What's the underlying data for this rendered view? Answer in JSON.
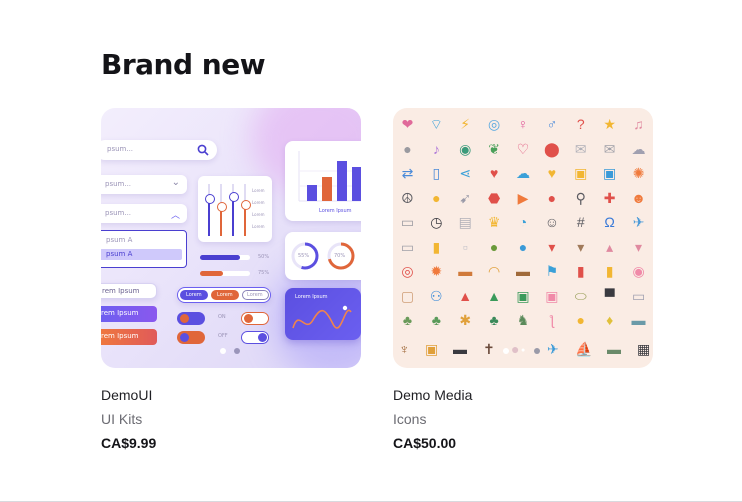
{
  "section": {
    "title": "Brand new"
  },
  "products": [
    {
      "name": "DemoUI",
      "category": "UI Kits",
      "price": "CA$9.99",
      "preview": {
        "search_placeholder": "psum...",
        "dropdown1": "psum...",
        "dropdown2": "psum...",
        "list_item1": "psum A",
        "list_item2": "psum A",
        "input_text": "rem Ipsum",
        "button1": "rem Ipsum",
        "button2": "rem Ipsum",
        "chart_caption": "Lorem Ipsum",
        "seg1": "Lorem",
        "seg2": "Lorem",
        "seg3": "Lorem",
        "toggle_on": "ON",
        "toggle_off": "OFF",
        "progress1": "50%",
        "progress2": "75%",
        "donut1": "55%",
        "donut2": "70%",
        "wave_title": "Lorem Ipsum",
        "slider_labels": [
          "Lorem",
          "Lorem",
          "Lorem",
          "Lorem"
        ]
      }
    },
    {
      "name": "Demo Media",
      "category": "Icons",
      "price": "CA$50.00",
      "preview": {
        "icons": [
          "heart-icon",
          "wifi-icon",
          "lightning-icon",
          "globe-icon",
          "female-icon",
          "male-icon",
          "question-icon",
          "star-icon",
          "music-icon",
          "chat-icon",
          "chat-music-icon",
          "earth-icon",
          "leaf-icon",
          "ribbon-icon",
          "pin-icon",
          "mail-open-icon",
          "mail-icon",
          "cloud-icon",
          "shuffle-icon",
          "phone-icon",
          "share-icon",
          "heartbeat-icon",
          "cloud-upload-icon",
          "heart-rainbow-icon",
          "lock-icon",
          "lock-open-icon",
          "gear-icon",
          "peace-icon",
          "coin-icon",
          "rocket-icon",
          "stop-sign-icon",
          "play-icon",
          "alert-icon",
          "magnifier-icon",
          "first-aid-icon",
          "user-icon",
          "tablet-icon",
          "clock-icon",
          "newspaper-icon",
          "trophy-icon",
          "pie-chart-icon",
          "smile-icon",
          "hashtag-icon",
          "headphones-icon",
          "plane-icon",
          "mug-icon",
          "drink-icon",
          "paper-icon",
          "avocado-icon",
          "hi-bubble-icon",
          "popcorn-icon",
          "coffee-icon",
          "cupcake-icon",
          "ice-drink-icon",
          "target-icon",
          "orange-icon",
          "hotdog-icon",
          "taco-icon",
          "burger-icon",
          "flag-icon",
          "bottles-icon",
          "sauce-icon",
          "donut-icon",
          "bag-icon",
          "scooter-icon",
          "hydrant-icon",
          "tree-icon",
          "gift-icon",
          "backpack-icon",
          "ufo-icon",
          "top-hat-icon",
          "stamp-icon",
          "cactus-pot-icon",
          "plant-icon",
          "pineapple-icon",
          "potted-plant-icon",
          "dinosaur-icon",
          "flamingo-icon",
          "balloon-icon",
          "pineapple2-icon",
          "ship-icon"
        ],
        "last_row": [
          "guitar-icon",
          "lantern-icon",
          "camera-icon",
          "cross-icon",
          "pig-icon",
          "dot-icon",
          "bird-icon",
          "sailboat-icon",
          "car-icon",
          "clapper-icon"
        ]
      }
    }
  ],
  "carousel": {
    "pages": 2,
    "active": 0
  },
  "colors": {
    "accent_purple": "#6b5ff0",
    "accent_orange": "#f07a3c",
    "icons_bg": "#faece4"
  }
}
